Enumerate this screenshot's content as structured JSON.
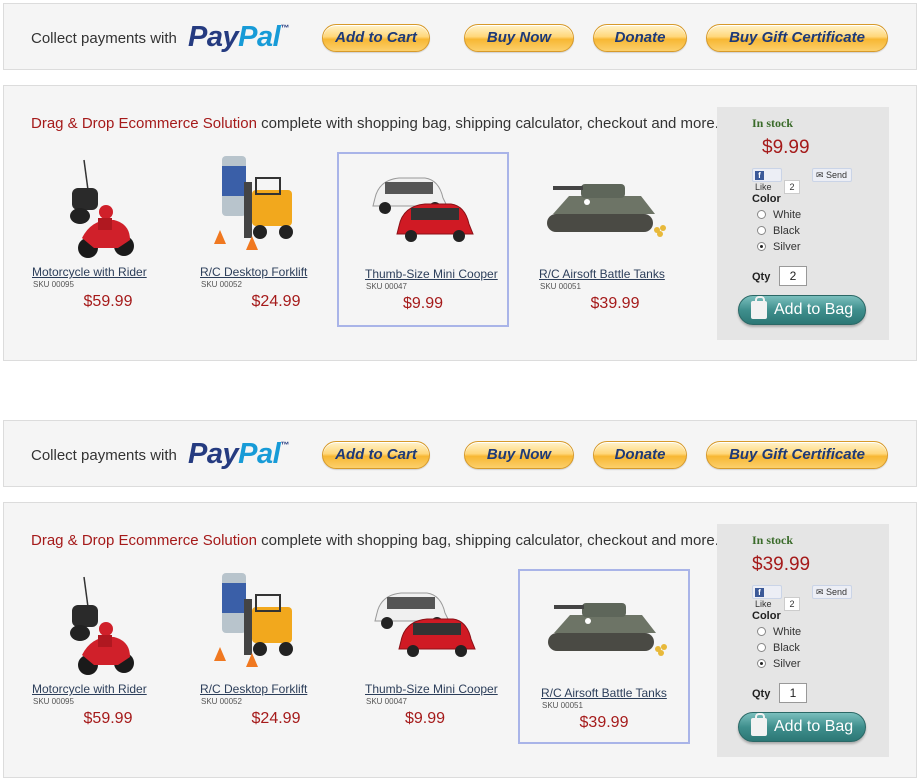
{
  "paypal": {
    "collect_label": "Collect payments with",
    "logo_pay": "Pay",
    "logo_pal": "Pal",
    "logo_tm": "™",
    "buttons": [
      "Add to Cart",
      "Buy Now",
      "Donate",
      "Buy Gift Certificate"
    ]
  },
  "tagline": {
    "highlight": "Drag & Drop Ecommerce Solution",
    "rest": " complete with shopping bag, shipping calculator, checkout and more."
  },
  "products": [
    {
      "name": "Motorcycle with Rider",
      "sku": "SKU 00095",
      "price": "$59.99",
      "icon": "motorcycle-toy-image"
    },
    {
      "name": "R/C Desktop Forklift",
      "sku": "SKU 00052",
      "price": "$24.99",
      "icon": "forklift-toy-image"
    },
    {
      "name": "Thumb-Size Mini Cooper",
      "sku": "SKU 00047",
      "price": "$9.99",
      "icon": "mini-cooper-toy-image"
    },
    {
      "name": "R/C Airsoft Battle Tanks",
      "sku": "SKU 00051",
      "price": "$39.99",
      "icon": "battle-tank-toy-image"
    }
  ],
  "panels": [
    {
      "selected_product": 2,
      "stock": "In stock",
      "price": "$9.99",
      "like_label": "Like",
      "like_count": "2",
      "send_label": "Send",
      "color_label": "Color",
      "colors": [
        "White",
        "Black",
        "Silver"
      ],
      "selected_color": "Silver",
      "qty_label": "Qty",
      "qty": "2",
      "add_to_bag": "Add to Bag"
    },
    {
      "selected_product": 3,
      "stock": "In stock",
      "price": "$39.99",
      "like_label": "Like",
      "like_count": "2",
      "send_label": "Send",
      "color_label": "Color",
      "colors": [
        "White",
        "Black",
        "Silver"
      ],
      "selected_color": "Silver",
      "qty_label": "Qty",
      "qty": "1",
      "add_to_bag": "Add to Bag"
    }
  ],
  "colors": {
    "accent_red": "#a51a1a",
    "paypal_navy": "#253b80",
    "paypal_blue": "#179bd7",
    "stock_green": "#3a6b2a",
    "bag_teal": "#3f8f8d"
  }
}
